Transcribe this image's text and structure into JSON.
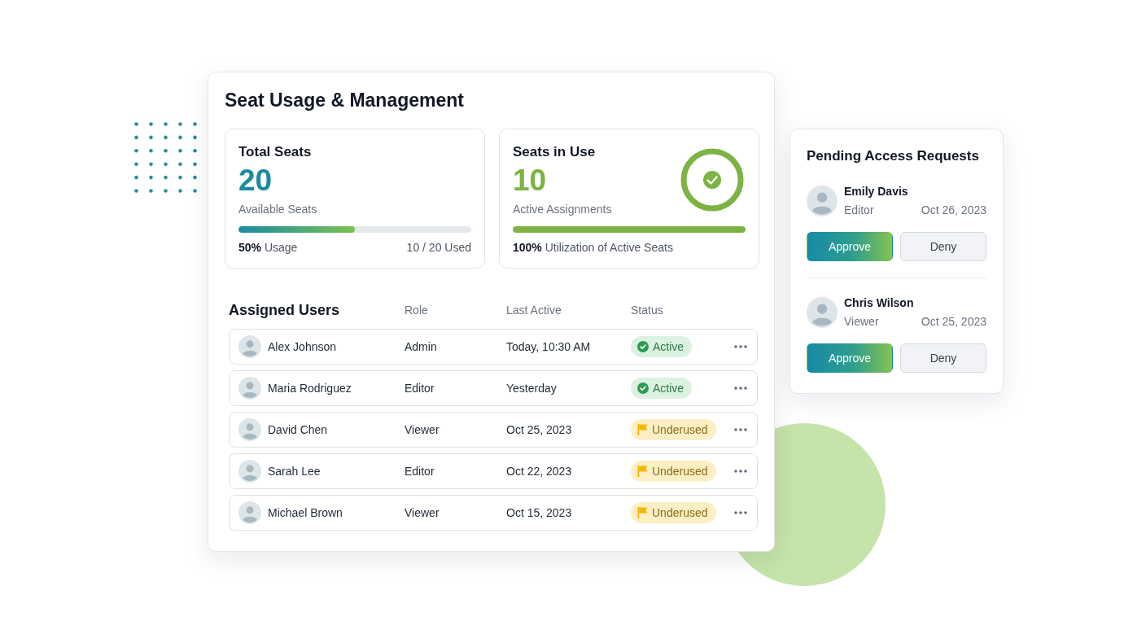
{
  "main_panel": {
    "title": "Seat Usage & Management",
    "stats": [
      {
        "kind": "plain",
        "label": "Total Seats",
        "value": "20",
        "color": "#1b8ca0",
        "caption": "Available Seats",
        "level": 0.5,
        "summary": "**50%** Usage",
        "used": "10 / 20 Used"
      },
      {
        "kind": "ring",
        "label": "Seats in Use",
        "value": "10",
        "color": "#7cb342",
        "caption": "Active Assignments",
        "level": 1.0,
        "summary": "**100%** Utilization of Active Seats"
      }
    ],
    "assigned_users": {
      "title": "Assigned Users",
      "columns": [
        "Role",
        "Last Active",
        "Status"
      ],
      "rows": [
        {
          "name": "Alex Johnson",
          "role": "Admin",
          "last_active": "Today, 10:30 AM",
          "status": {
            "kind": "active",
            "label": "Active"
          }
        },
        {
          "name": "Maria Rodriguez",
          "role": "Editor",
          "last_active": "Yesterday",
          "status": {
            "kind": "active",
            "label": "Active"
          }
        },
        {
          "name": "David Chen",
          "role": "Viewer",
          "last_active": "Oct 25, 2023",
          "status": {
            "kind": "underused",
            "label": "Underused"
          }
        },
        {
          "name": "Sarah Lee",
          "role": "Editor",
          "last_active": "Oct 22, 2023",
          "status": {
            "kind": "underused",
            "label": "Underused"
          }
        },
        {
          "name": "Michael Brown",
          "role": "Viewer",
          "last_active": "Oct 15, 2023",
          "status": {
            "kind": "underused",
            "label": "Underused"
          }
        }
      ]
    }
  },
  "pending_requests": {
    "title": "Pending Access Requests",
    "requests": [
      {
        "name": "Emily Davis",
        "role": "Editor",
        "date": "Oct 26, 2023",
        "buttons": [
          {
            "kind": "approve",
            "label": "Approve"
          },
          {
            "kind": "deny",
            "label": "Deny"
          }
        ]
      },
      {
        "name": "Chris Wilson",
        "role": "Viewer",
        "date": "Oct 25, 2023",
        "buttons": [
          {
            "kind": "approve",
            "label": "Approve"
          },
          {
            "kind": "deny",
            "label": "Deny"
          }
        ]
      }
    ]
  }
}
